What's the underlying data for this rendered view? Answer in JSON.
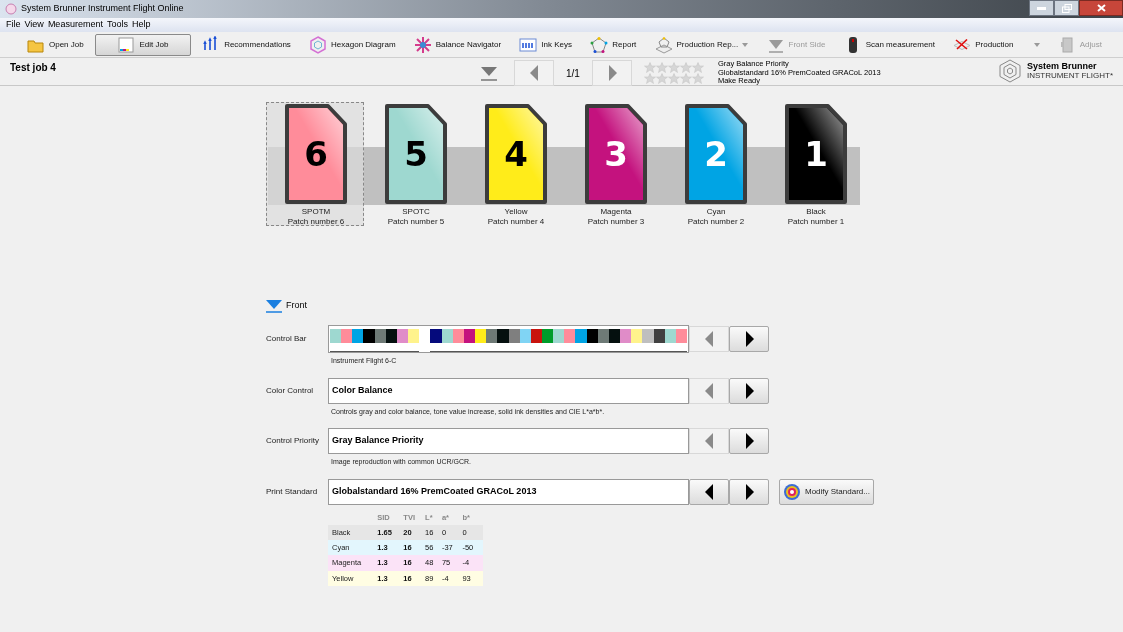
{
  "window": {
    "title": "System Brunner Instrument Flight Online"
  },
  "menu": [
    "File",
    "View",
    "Measurement",
    "Tools",
    "Help"
  ],
  "toolbar": [
    {
      "kind": "open",
      "label": "Open Job",
      "selected": false,
      "disabled": false,
      "dropdown": false
    },
    {
      "kind": "edit",
      "label": "Edit Job",
      "selected": true,
      "disabled": false,
      "dropdown": false
    },
    {
      "kind": "recommend",
      "label": "Recommendations",
      "selected": false,
      "disabled": false,
      "dropdown": false
    },
    {
      "kind": "hexagon",
      "label": "Hexagon Diagram",
      "selected": false,
      "disabled": false,
      "dropdown": false
    },
    {
      "kind": "navigator",
      "label": "Balance Navigator",
      "selected": false,
      "disabled": false,
      "dropdown": false
    },
    {
      "kind": "inkkeys",
      "label": "Ink Keys",
      "selected": false,
      "disabled": false,
      "dropdown": false
    },
    {
      "kind": "report",
      "label": "Report",
      "selected": false,
      "disabled": false,
      "dropdown": false
    },
    {
      "kind": "prodreport",
      "label": "Production Rep...",
      "selected": false,
      "disabled": false,
      "dropdown": true
    },
    {
      "kind": "side",
      "label": "Front Side",
      "selected": false,
      "disabled": true,
      "dropdown": false
    },
    {
      "kind": "scan",
      "label": "Scan measurement",
      "selected": false,
      "disabled": false,
      "dropdown": false
    },
    {
      "kind": "production",
      "label": "Production",
      "selected": false,
      "disabled": false,
      "dropdown": true
    },
    {
      "kind": "adjust",
      "label": "Adjust",
      "selected": false,
      "disabled": true,
      "dropdown": false
    }
  ],
  "job": {
    "title": "Test job 4",
    "page": "1/1",
    "prev_disabled": true,
    "next_disabled": true,
    "ratings": [
      {
        "stars": 0
      },
      {
        "stars": 0
      }
    ],
    "status_lines": [
      "Gray Balance Priority",
      "Globalstandard 16% PremCoated GRACoL 2013",
      "Make Ready"
    ],
    "brand": {
      "name": "System Brunner",
      "subtitle": "INSTRUMENT FLIGHT*"
    }
  },
  "patches": [
    {
      "number": "6",
      "name": "SPOTM",
      "caption": "Patch number 6",
      "color": "#ff8c9a",
      "selected": true
    },
    {
      "number": "5",
      "name": "SPOTC",
      "caption": "Patch number 5",
      "color": "#9ed8d0",
      "selected": false
    },
    {
      "number": "4",
      "name": "Yellow",
      "caption": "Patch number 4",
      "color": "#ffec1a",
      "selected": false
    },
    {
      "number": "3",
      "name": "Magenta",
      "caption": "Patch number 3",
      "color": "#c4127e",
      "selected": false
    },
    {
      "number": "2",
      "name": "Cyan",
      "caption": "Patch number 2",
      "color": "#00a4e4",
      "selected": false
    },
    {
      "number": "1",
      "name": "Black",
      "caption": "Patch number 1",
      "color": "#000000",
      "selected": false
    }
  ],
  "side": {
    "label": "Front",
    "expanded": true
  },
  "settings": [
    {
      "kind": "control_bar",
      "label": "Control Bar",
      "caption": "Instrument Flight 6-C",
      "prev_disabled": true,
      "next_disabled": false,
      "control_bar": [
        {
          "kind": "patch",
          "color": "#9ed8d0"
        },
        {
          "kind": "patch",
          "color": "#ff8c9a"
        },
        {
          "kind": "patch",
          "color": "#00a4e4"
        },
        {
          "kind": "patch",
          "color": "#000000"
        },
        {
          "kind": "patch",
          "color": "#6e7a76"
        },
        {
          "kind": "patch",
          "color": "#05100f"
        },
        {
          "kind": "patch",
          "color": "#e08cc8"
        },
        {
          "kind": "patch",
          "color": "#fff38c"
        },
        {
          "kind": "blank"
        },
        {
          "kind": "patch",
          "color": "#050a7c"
        },
        {
          "kind": "patch",
          "color": "#9ed8d0"
        },
        {
          "kind": "patch",
          "color": "#ff8c9a"
        },
        {
          "kind": "patch",
          "color": "#c4127e"
        },
        {
          "kind": "patch",
          "color": "#ffec1a"
        },
        {
          "kind": "patch",
          "color": "#6e7a76"
        },
        {
          "kind": "patch",
          "color": "#05100f"
        },
        {
          "kind": "patch",
          "color": "#7f7f7f"
        },
        {
          "kind": "patch",
          "color": "#80d4f4"
        },
        {
          "kind": "patch",
          "color": "#c8140e"
        },
        {
          "kind": "patch",
          "color": "#009c2a"
        },
        {
          "kind": "patch",
          "color": "#9ed8d0"
        },
        {
          "kind": "patch",
          "color": "#ff8c9a"
        },
        {
          "kind": "patch",
          "color": "#00a4e4"
        },
        {
          "kind": "patch",
          "color": "#000000"
        },
        {
          "kind": "patch",
          "color": "#6e7a76"
        },
        {
          "kind": "patch",
          "color": "#05100f"
        },
        {
          "kind": "patch",
          "color": "#e08cc8"
        },
        {
          "kind": "patch",
          "color": "#fff38c"
        },
        {
          "kind": "patch",
          "color": "#bfbfbf"
        },
        {
          "kind": "patch",
          "color": "#404040"
        },
        {
          "kind": "patch",
          "color": "#9ed8d0"
        },
        {
          "kind": "patch",
          "color": "#ff8c9a"
        }
      ]
    },
    {
      "kind": "select",
      "label": "Color Control",
      "value": "Color Balance",
      "caption": "Controls gray and color balance, tone value increase, solid ink densities and CIE L*a*b*.",
      "prev_disabled": true,
      "next_disabled": false
    },
    {
      "kind": "select",
      "label": "Control Priority",
      "value": "Gray Balance Priority",
      "caption": "Image reproduction with common UCR/GCR.",
      "prev_disabled": true,
      "next_disabled": false
    },
    {
      "kind": "select",
      "label": "Print Standard",
      "value": "Globalstandard 16% PremCoated GRACoL 2013",
      "prev_disabled": false,
      "next_disabled": false,
      "action": "Modify Standard..."
    }
  ],
  "standard_table": {
    "columns": [
      "SID",
      "TVI",
      "L*",
      "a*",
      "b*"
    ],
    "rows": [
      {
        "name": "Black",
        "color": "#e6e6e6",
        "cells": [
          "1.65",
          "20",
          "16",
          "0",
          "0"
        ]
      },
      {
        "name": "Cyan",
        "color": "#e3f6fd",
        "cells": [
          "1.3",
          "16",
          "56",
          "-37",
          "-50"
        ]
      },
      {
        "name": "Magenta",
        "color": "#fbe3f7",
        "cells": [
          "1.3",
          "16",
          "48",
          "75",
          "-4"
        ]
      },
      {
        "name": "Yellow",
        "color": "#fffde3",
        "cells": [
          "1.3",
          "16",
          "89",
          "-4",
          "93"
        ]
      }
    ]
  }
}
